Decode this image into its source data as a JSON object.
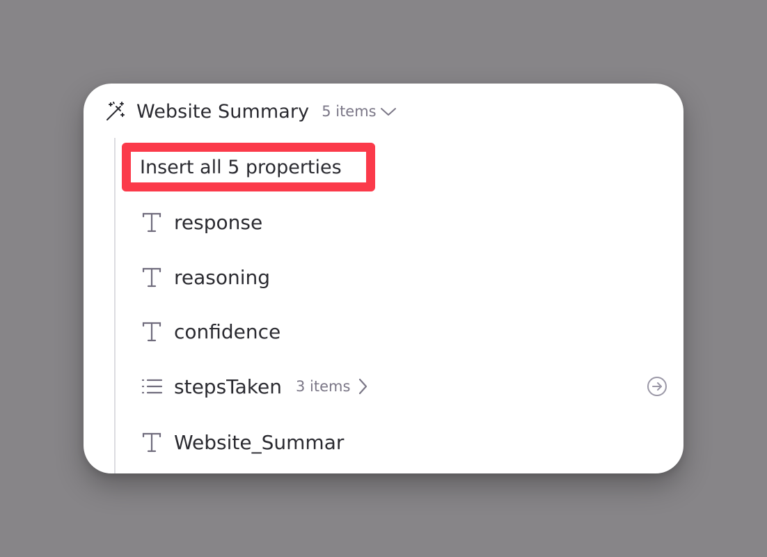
{
  "group": {
    "title": "Website Summary",
    "count": "5 items",
    "icon": "magic-wand-icon"
  },
  "insert_all": {
    "label": "Insert all 5 properties",
    "highlight_color": "#fb3a4a"
  },
  "properties": [
    {
      "label": "response",
      "icon": "text-type-icon"
    },
    {
      "label": "reasoning",
      "icon": "text-type-icon"
    },
    {
      "label": "confidence",
      "icon": "text-type-icon"
    },
    {
      "label": "stepsTaken",
      "icon": "list-type-icon",
      "count": "3 items",
      "action_icon": "arrow-circle-right-icon"
    },
    {
      "label": "Website_Summar",
      "icon": "text-type-icon"
    }
  ],
  "colors": {
    "backdrop": "#878588",
    "card": "#ffffff",
    "text": "#2a2a30",
    "muted": "#7a7686"
  }
}
